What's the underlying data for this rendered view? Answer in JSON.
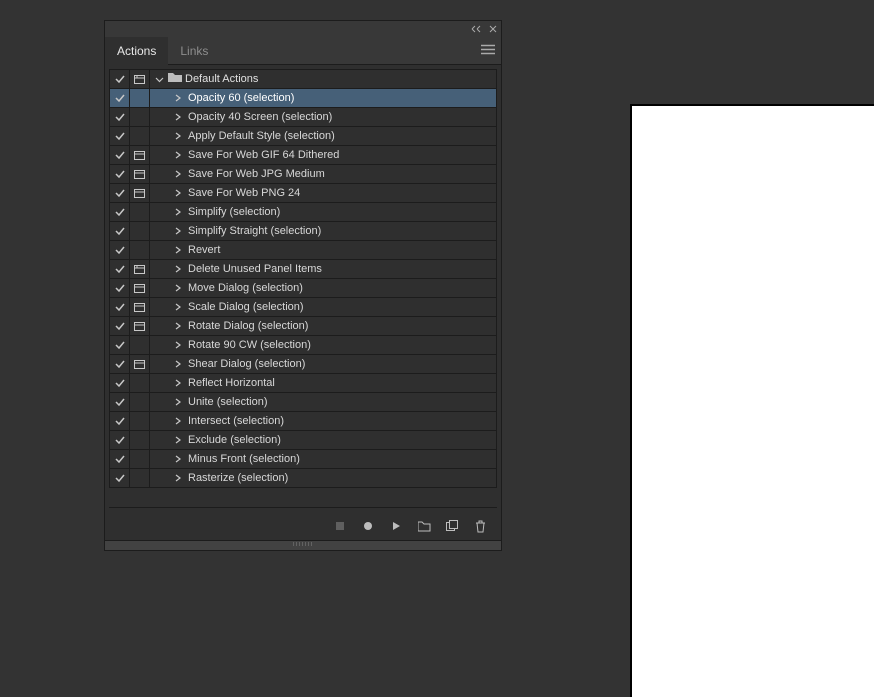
{
  "tabs": {
    "actions": "Actions",
    "links": "Links"
  },
  "set_name": "Default Actions",
  "actions": [
    {
      "name": "Opacity 60 (selection)",
      "dialog": "none",
      "selected": true
    },
    {
      "name": "Opacity 40 Screen (selection)",
      "dialog": "none",
      "selected": false
    },
    {
      "name": "Apply Default Style (selection)",
      "dialog": "none",
      "selected": false
    },
    {
      "name": "Save For Web GIF 64 Dithered",
      "dialog": "on",
      "selected": false
    },
    {
      "name": "Save For Web JPG Medium",
      "dialog": "on",
      "selected": false
    },
    {
      "name": "Save For Web PNG 24",
      "dialog": "on",
      "selected": false
    },
    {
      "name": "Simplify (selection)",
      "dialog": "none",
      "selected": false
    },
    {
      "name": "Simplify Straight (selection)",
      "dialog": "none",
      "selected": false
    },
    {
      "name": "Revert",
      "dialog": "none",
      "selected": false
    },
    {
      "name": "Delete Unused Panel Items",
      "dialog": "mixed",
      "selected": false
    },
    {
      "name": "Move Dialog (selection)",
      "dialog": "on",
      "selected": false
    },
    {
      "name": "Scale Dialog (selection)",
      "dialog": "on",
      "selected": false
    },
    {
      "name": "Rotate Dialog (selection)",
      "dialog": "on",
      "selected": false
    },
    {
      "name": "Rotate 90 CW (selection)",
      "dialog": "none",
      "selected": false
    },
    {
      "name": "Shear Dialog (selection)",
      "dialog": "on",
      "selected": false
    },
    {
      "name": "Reflect Horizontal",
      "dialog": "none",
      "selected": false
    },
    {
      "name": "Unite (selection)",
      "dialog": "none",
      "selected": false
    },
    {
      "name": "Intersect (selection)",
      "dialog": "none",
      "selected": false
    },
    {
      "name": "Exclude (selection)",
      "dialog": "none",
      "selected": false
    },
    {
      "name": "Minus Front (selection)",
      "dialog": "none",
      "selected": false
    },
    {
      "name": "Rasterize (selection)",
      "dialog": "none",
      "selected": false
    }
  ]
}
